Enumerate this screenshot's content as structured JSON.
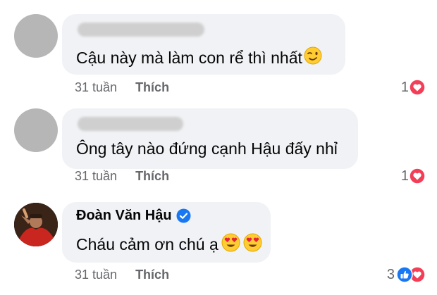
{
  "comments": [
    {
      "author_visible": false,
      "text": "Cậu này mà làm con rể thì nhất",
      "emoji": "wink-emoji",
      "time": "31 tuần",
      "like_label": "Thích",
      "reaction_count": "1",
      "reactions": [
        "heart-icon"
      ]
    },
    {
      "author_visible": false,
      "text": "Ông tây nào đứng cạnh Hậu đấy nhỉ",
      "time": "31 tuần",
      "like_label": "Thích",
      "reaction_count": "1",
      "reactions": [
        "heart-icon"
      ]
    },
    {
      "author": "Đoàn Văn Hậu",
      "verified": true,
      "text": "Cháu cảm ơn chú ạ",
      "emoji": "heart-eyes-emoji x2",
      "time": "31 tuần",
      "like_label": "Thích",
      "reaction_count": "3",
      "reactions": [
        "like-icon",
        "heart-icon"
      ]
    }
  ],
  "colors": {
    "bubble": "#f0f2f5",
    "meta_text": "#65676b",
    "heart": "#f33e58",
    "like": "#1877f2",
    "verified": "#1877f2"
  }
}
